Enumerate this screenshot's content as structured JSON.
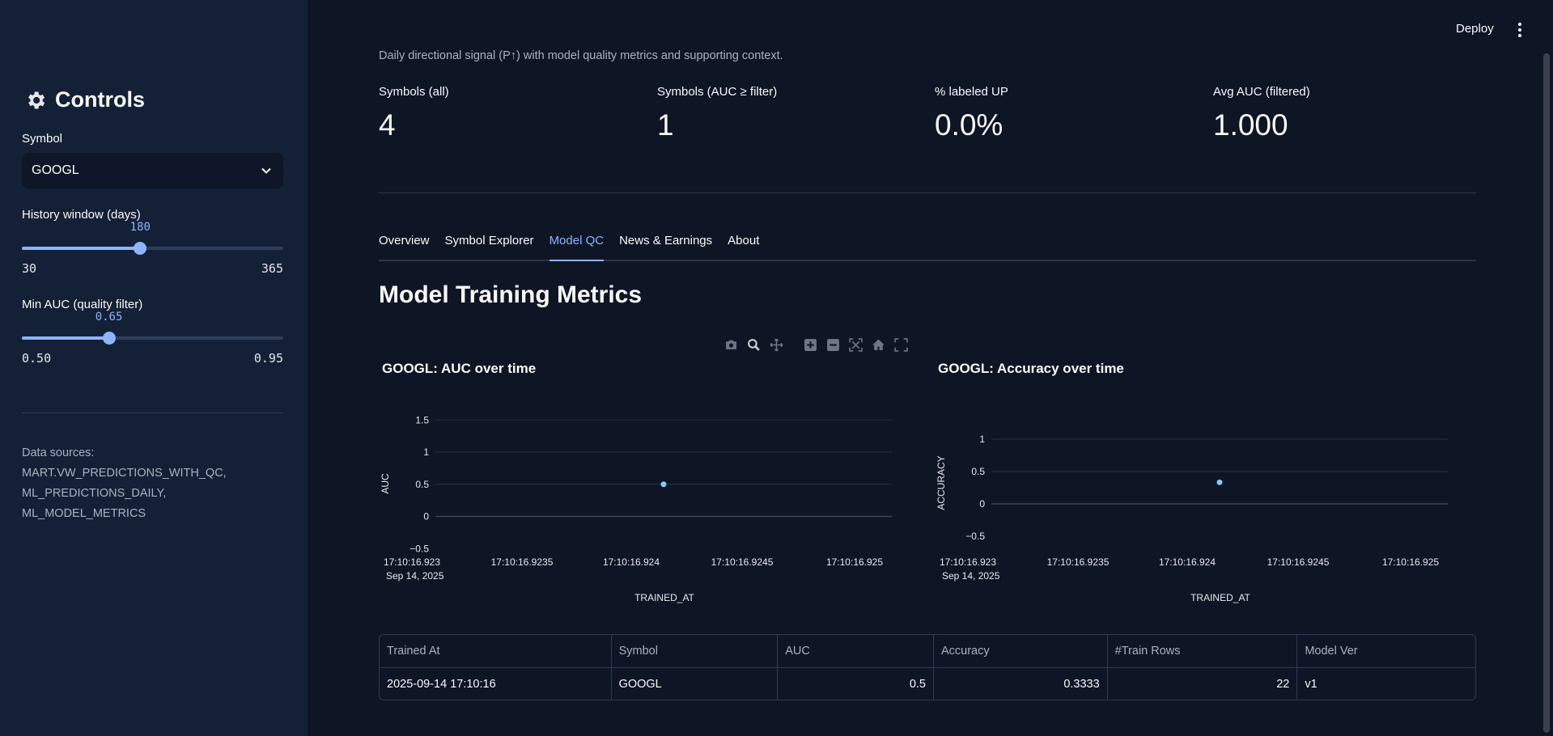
{
  "sidebar": {
    "title": "Controls",
    "symbol_label": "Symbol",
    "symbol_value": "GOOGL",
    "history": {
      "label": "History window (days)",
      "value": "180",
      "min": "30",
      "max": "365",
      "fraction": 0.453
    },
    "min_auc": {
      "label": "Min AUC (quality filter)",
      "value": "0.65",
      "min": "0.50",
      "max": "0.95",
      "fraction": 0.333
    },
    "sources": "Data sources: MART.VW_PREDICTIONS_WITH_QC, ML_PREDICTIONS_DAILY, ML_MODEL_METRICS"
  },
  "header": {
    "deploy": "Deploy"
  },
  "subtitle": "Daily directional signal (P↑) with model quality metrics and supporting context.",
  "metrics": [
    {
      "label": "Symbols (all)",
      "value": "4"
    },
    {
      "label": "Symbols (AUC ≥ filter)",
      "value": "1"
    },
    {
      "label": "% labeled UP",
      "value": "0.0%"
    },
    {
      "label": "Avg AUC (filtered)",
      "value": "1.000"
    }
  ],
  "tabs": [
    "Overview",
    "Symbol Explorer",
    "Model QC",
    "News & Earnings",
    "About"
  ],
  "active_tab": "Model QC",
  "section_title": "Model Training Metrics",
  "toolbar_icons": [
    "camera-icon",
    "zoom-icon",
    "pan-icon",
    "zoom-in-icon",
    "zoom-out-icon",
    "autoscale-icon",
    "home-icon",
    "fullscreen-icon"
  ],
  "chart_data": [
    {
      "type": "scatter",
      "title": "GOOGL: AUC over time",
      "xlabel": "TRAINED_AT",
      "ylabel": "AUC",
      "x_tick_labels": [
        "17:10:16.923",
        "17:10:16.9235",
        "17:10:16.924",
        "17:10:16.9245",
        "17:10:16.925"
      ],
      "x_tick_date": "Sep 14, 2025",
      "y_ticks": [
        "1.5",
        "1",
        "0.5",
        "0",
        "−0.5"
      ],
      "ylim": [
        -0.5,
        1.5
      ],
      "x": [
        "2025-09-14 17:10:16.924"
      ],
      "y": [
        0.5
      ],
      "color": "#83c9ff"
    },
    {
      "type": "scatter",
      "title": "GOOGL: Accuracy over time",
      "xlabel": "TRAINED_AT",
      "ylabel": "ACCURACY",
      "x_tick_labels": [
        "17:10:16.923",
        "17:10:16.9235",
        "17:10:16.924",
        "17:10:16.9245",
        "17:10:16.925"
      ],
      "x_tick_date": "Sep 14, 2025",
      "y_ticks": [
        "1",
        "0.5",
        "0",
        "−0.5"
      ],
      "ylim": [
        -0.5,
        1
      ],
      "x": [
        "2025-09-14 17:10:16.924"
      ],
      "y": [
        0.3333
      ],
      "color": "#83c9ff"
    }
  ],
  "table": {
    "columns": [
      "Trained At",
      "Symbol",
      "AUC",
      "Accuracy",
      "#Train Rows",
      "Model Ver"
    ],
    "rows": [
      [
        "2025-09-14 17:10:16",
        "GOOGL",
        "0.5",
        "0.3333",
        "22",
        "v1"
      ]
    ]
  }
}
